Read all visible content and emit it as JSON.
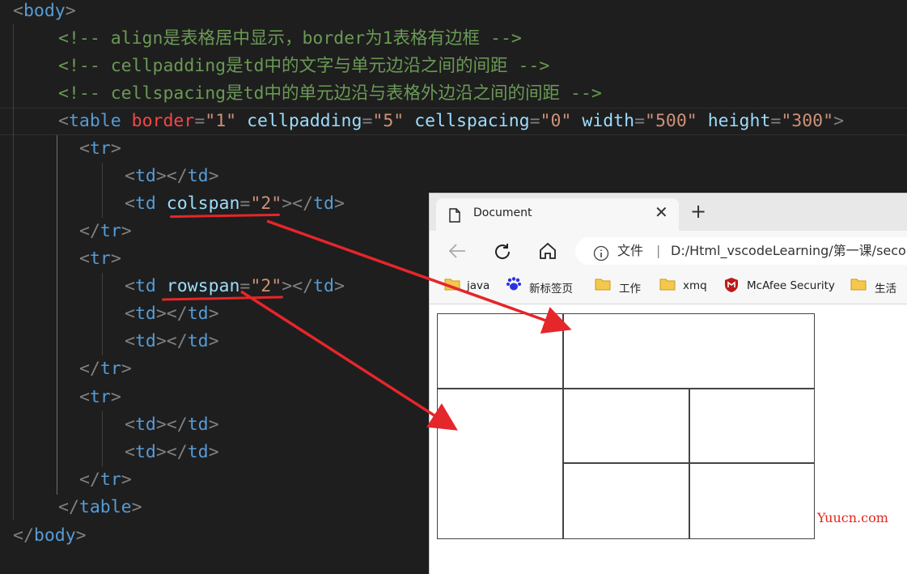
{
  "code": {
    "body_open": "body",
    "comment1": "<!-- align是表格居中显示，border为1表格有边框 -->",
    "comment2": "<!-- cellpadding是td中的文字与单元边沿之间的间距 -->",
    "comment3": "<!-- cellspacing是td中的单元边沿与表格外边沿之间的间距 -->",
    "table_tag": "table",
    "attr_border": "border",
    "val_border": "\"1\"",
    "attr_cellpadding": "cellpadding",
    "val_cellpadding": "\"5\"",
    "attr_cellspacing": "cellspacing",
    "val_cellspacing": "\"0\"",
    "attr_width": "width",
    "val_width": "\"500\"",
    "attr_height": "height",
    "val_height": "\"300\"",
    "tr": "tr",
    "td": "td",
    "attr_colspan": "colspan",
    "val_colspan": "\"2\"",
    "attr_rowspan": "rowspan",
    "val_rowspan": "\"2\"",
    "body_close": "body"
  },
  "browser": {
    "tab_title": "Document",
    "close_glyph": "✕",
    "newtab_glyph": "+",
    "address_label": "文件",
    "address_sep": "|",
    "address_url": "D:/Html_vscodeLearning/第一课/secor",
    "bookmarks": [
      "java",
      "新标签页",
      "工作",
      "xmq",
      "McAfee Security",
      "生活"
    ]
  },
  "watermark": "Yuucn.com",
  "colors": {
    "editor_bg": "#1e1e1e",
    "tag": "#569cd6",
    "attr": "#9cdcfe",
    "value": "#ce9178",
    "comment": "#6a9955",
    "arrow": "#e5262b"
  }
}
